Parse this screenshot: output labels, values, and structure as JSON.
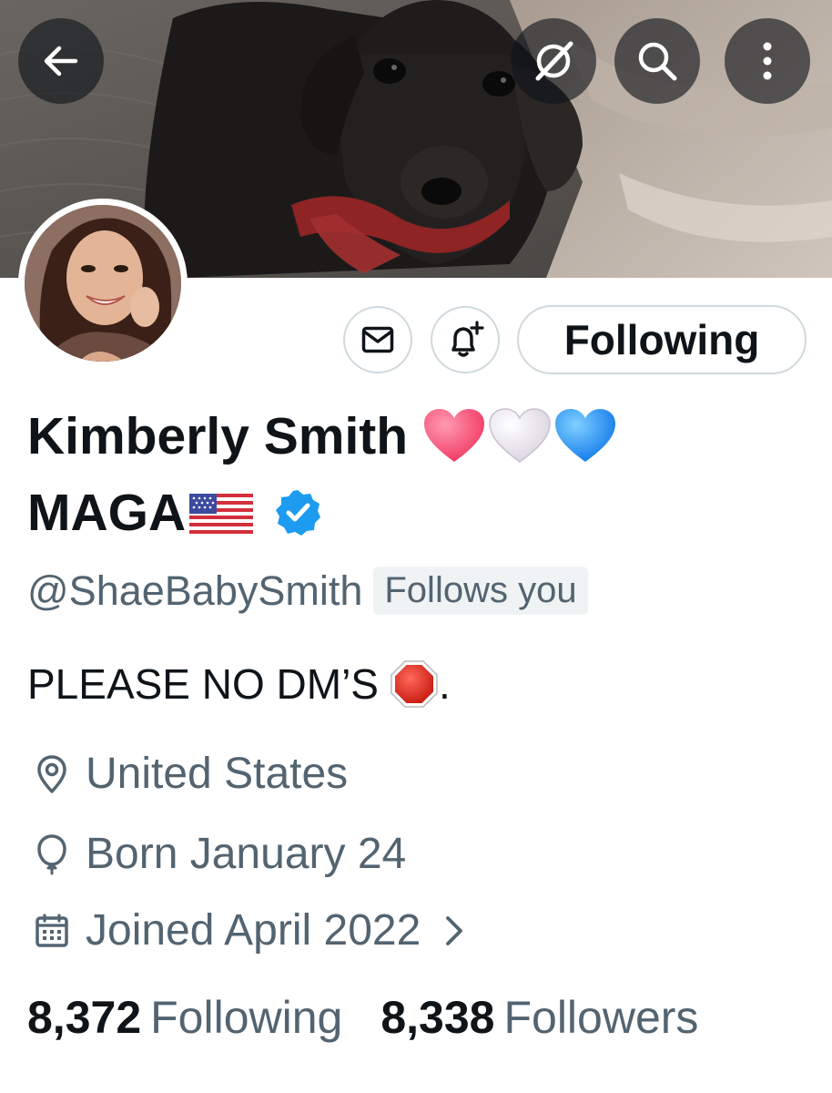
{
  "profile": {
    "name_line1": "Kimberly Smith",
    "name_line2": "MAGA",
    "handle": "@ShaeBabySmith",
    "follows_you": "Follows you",
    "bio": "PLEASE NO DM’S",
    "bio_suffix": ".",
    "location": "United States",
    "birthday": "Born January 24",
    "joined": "Joined April 2022",
    "verified": true
  },
  "actions": {
    "following_label": "Following"
  },
  "stats": {
    "following_count": "8,372",
    "following_label": "Following",
    "followers_count": "8,338",
    "followers_label": "Followers"
  },
  "icons": {
    "back": "arrow-left-icon",
    "grok": "grok-icon",
    "search": "search-icon",
    "more": "more-vertical-icon",
    "message": "envelope-icon",
    "notify": "bell-plus-icon",
    "location": "location-pin-icon",
    "birthday": "balloon-icon",
    "joined": "calendar-icon",
    "joined_chevron": "chevron-right-icon",
    "verified": "verified-badge-icon",
    "stop": "stop-sign-emoji",
    "flag": "us-flag-emoji",
    "hearts": [
      "pink-heart-emoji",
      "white-heart-emoji",
      "blue-heart-emoji"
    ]
  },
  "colors": {
    "text_primary": "#0f1419",
    "text_secondary": "#536471",
    "border": "#cfd9de",
    "verified_blue": "#1d9bf0",
    "badge_bg": "#eff3f4"
  }
}
